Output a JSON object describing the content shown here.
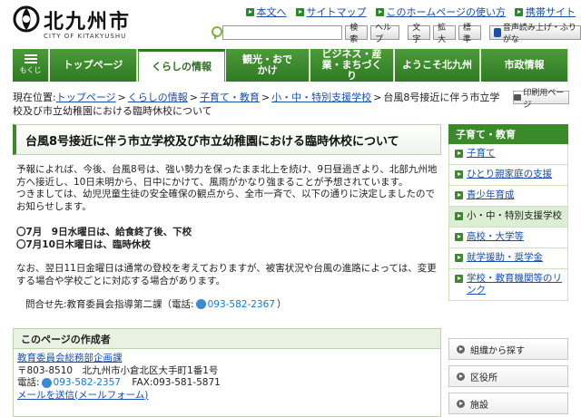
{
  "header": {
    "logo_title": "北九州市",
    "logo_sub": "CITY OF KITAKYUSHU",
    "top_links": [
      "本文へ",
      "サイトマップ",
      "このホームページの使い方",
      "携帯サイト"
    ],
    "search_button": "検索",
    "help_button": "ヘルプ",
    "text_label": "文字",
    "enlarge_button": "拡大",
    "standard_button": "標準",
    "audio_button": "音声読み上げ・ふりがな"
  },
  "nav": {
    "menu_label": "もくじ",
    "items": [
      "トップページ",
      "くらしの情報",
      "観光・おでかけ",
      "ビジネス・産業・まちづくり",
      "ようこそ北九州",
      "市政情報"
    ]
  },
  "breadcrumb": {
    "prefix": "現在位置:",
    "links": [
      "トップページ",
      "くらしの情報",
      "子育て・教育",
      "小・中・特別支援学校"
    ],
    "current": "台風8号接近に伴う市立学校及び市立幼稚園における臨時休校について",
    "print_label": "印刷用ページ"
  },
  "article": {
    "title": "台風8号接近に伴う市立学校及び市立幼稚園における臨時休校について",
    "para1": "予報によれば、今後、台風8号は、強い勢力を保ったまま北上を続け、9日昼過ぎより、北部九州地方へ接近し、10日未明から、日中にかけて、風雨がかなり強まることが予想されています。",
    "para2": "つきましては、幼児児童生徒の安全確保の観点から、全市一斉で、以下の通りに決定しましたのでお知らせします。",
    "notice1": "〇7月　9日水曜日は、給食終了後、下校",
    "notice2": "〇7月10日木曜日は、臨時休校",
    "followup": "なお、翌日11日金曜日は通常の登校を考えておりますが、被害状況や台風の進路によっては、変更する場合や学校ごとに対応する場合があります。",
    "contact_prefix": "問合せ先:教育委員会指導第二課（電話:",
    "contact_phone": "093-582-2367",
    "contact_suffix": "）"
  },
  "author": {
    "heading": "このページの作成者",
    "dept": "教育委員会総務部企画課",
    "address": "〒803-8510　北九州市小倉北区大手町1番1号",
    "phone_label": "電話:",
    "phone": "093-582-2357",
    "fax": "　FAX:093-581-5871",
    "mail": "メールを送信(メールフォーム)"
  },
  "sidebar": {
    "heading": "子育て・教育",
    "items": [
      "子育て",
      "ひとり親家庭の支援",
      "青少年育成",
      "小・中・特別支援学校",
      "高校・大学等",
      "就学援助・奨学金",
      "学校・教育機関等のリンク"
    ],
    "boxes": [
      "組織から探す",
      "区役所",
      "施設"
    ]
  }
}
